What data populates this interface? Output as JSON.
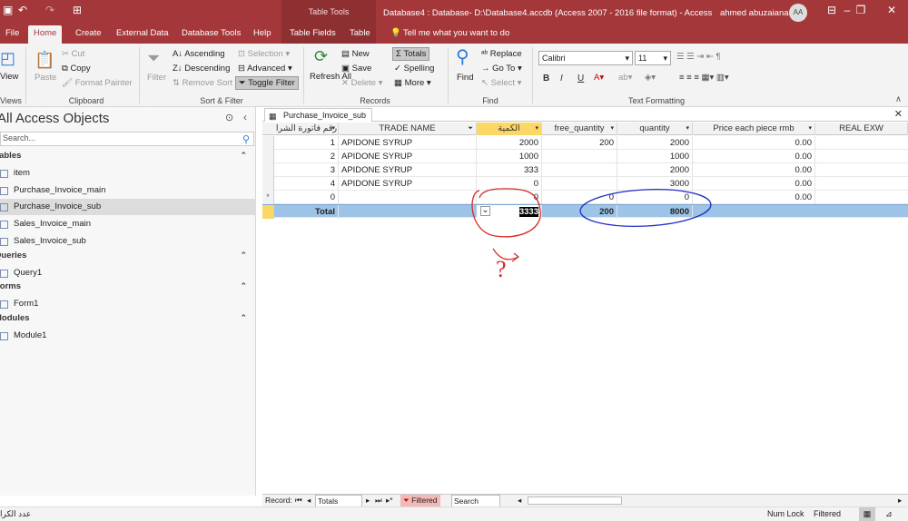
{
  "titlebar": {
    "context_label": "Table Tools",
    "title": "Database4 : Database- D:\\Database4.accdb (Access 2007 - 2016 file format)  -  Access",
    "user": "ahmed abuzaiana",
    "avatar": "AA",
    "tell_me": "Tell me what you want to do"
  },
  "tabs": [
    "File",
    "Home",
    "Create",
    "External Data",
    "Database Tools",
    "Help",
    "Table Fields",
    "Table"
  ],
  "ribbon": {
    "view": "View",
    "paste": "Paste",
    "cut": "Cut",
    "copy": "Copy",
    "format_painter": "Format Painter",
    "filter": "Filter",
    "ascending": "Ascending",
    "descending": "Descending",
    "remove_sort": "Remove Sort",
    "selection": "Selection",
    "advanced": "Advanced",
    "toggle_filter": "Toggle Filter",
    "refresh_all": "Refresh All",
    "new": "New",
    "save": "Save",
    "delete": "Delete",
    "totals": "Totals",
    "spelling": "Spelling",
    "more": "More",
    "find": "Find",
    "replace": "Replace",
    "goto": "Go To",
    "select": "Select",
    "font": "Calibri",
    "font_size": "11",
    "bold": "B",
    "italic": "I",
    "underline": "U",
    "groups": {
      "views": "Views",
      "clipboard": "Clipboard",
      "sort_filter": "Sort & Filter",
      "records": "Records",
      "find": "Find",
      "text_formatting": "Text Formatting"
    }
  },
  "nav": {
    "header": "All Access Objects",
    "search_placeholder": "Search...",
    "categories": [
      {
        "name": "Tables",
        "items": [
          "item",
          "Purchase_Invoice_main",
          "Purchase_Invoice_sub",
          "Sales_Invoice_main",
          "Sales_Invoice_sub"
        ]
      },
      {
        "name": "Queries",
        "items": [
          "Query1"
        ]
      },
      {
        "name": "Forms",
        "items": [
          "Form1"
        ]
      },
      {
        "name": "Modules",
        "items": [
          "Module1"
        ]
      }
    ],
    "selected": "Purchase_Invoice_sub"
  },
  "doc": {
    "tab": "Purchase_Invoice_sub",
    "columns": [
      "رقم فاتورة الشرا",
      "TRADE NAME",
      "الكمية",
      "free_quantity",
      "quantity",
      "Price each piece rmb",
      "REAL EXW"
    ],
    "rows": [
      [
        "1",
        "APIDONE SYRUP",
        "2000",
        "200",
        "2000",
        "0.00"
      ],
      [
        "2",
        "APIDONE SYRUP",
        "1000",
        "",
        "1000",
        "0.00"
      ],
      [
        "3",
        "APIDONE SYRUP",
        "333",
        "",
        "2000",
        "0.00"
      ],
      [
        "4",
        "APIDONE SYRUP",
        "0",
        "",
        "3000",
        "0.00"
      ],
      [
        "0",
        "",
        "0",
        "0",
        "0",
        "0.00"
      ]
    ],
    "new_marker": "*",
    "total_row": [
      "Total",
      "3333",
      "200",
      "8000"
    ]
  },
  "record_nav": {
    "label": "Record:",
    "position": "Totals",
    "filtered": "Filtered",
    "search": "Search"
  },
  "annotation": {
    "question": "?"
  },
  "statusbar": {
    "left": "عدد الكرا",
    "num_lock": "Num Lock",
    "filtered": "Filtered"
  }
}
